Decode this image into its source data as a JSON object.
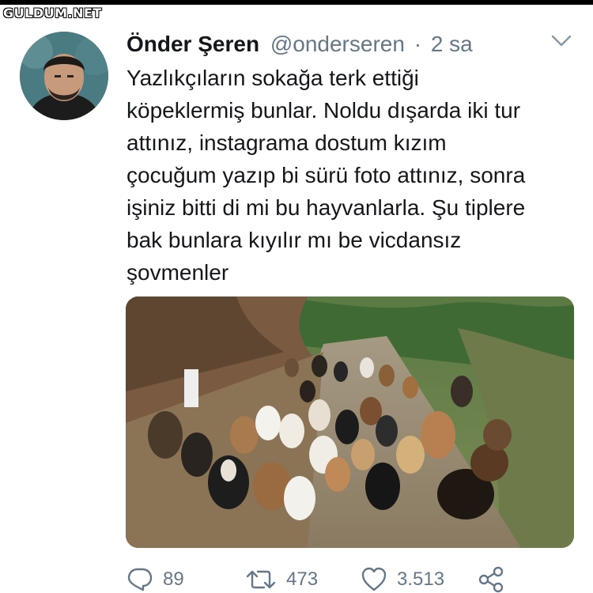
{
  "watermark": "GULDUM.NET",
  "tweet": {
    "display_name": "Önder Şeren",
    "handle": "@onderseren",
    "separator": "·",
    "time": "2 sa",
    "text_lines": [
      "Yazlıkçıların sokağa terk ettiği",
      "köpeklermiş bunlar. Noldu dışarda iki tur",
      "attınız, instagrama dostum kızım",
      "çocuğum yazıp bi sürü foto attınız, sonra",
      "işiniz bitti di mi bu hayvanlarla. Şu tiplere",
      "bak bunlara kıyılır mı be vicdansız",
      "şovmenler"
    ]
  },
  "actions": {
    "reply_count": "89",
    "retweet_count": "473",
    "like_count": "3.513"
  },
  "icons": {
    "caret": "chevron-down-icon",
    "reply": "reply-icon",
    "retweet": "retweet-icon",
    "like": "heart-icon",
    "share": "share-icon"
  },
  "colors": {
    "text": "#14171a",
    "secondary": "#657786"
  }
}
